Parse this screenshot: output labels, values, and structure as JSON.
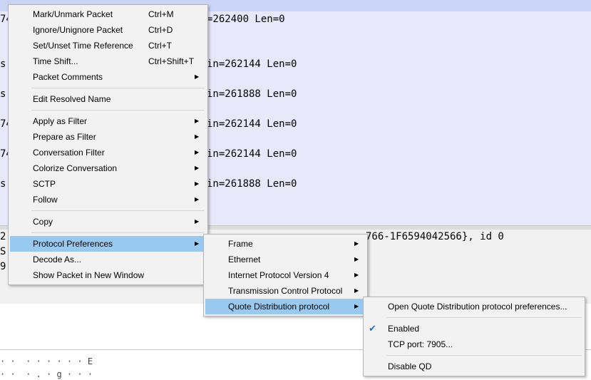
{
  "packet_list": {
    "rows": [
      {
        "left": "74",
        "right": "=262400 Len=0"
      },
      {
        "left": "",
        "right": ""
      },
      {
        "left": "s",
        "right": "in=262144 Len=0"
      },
      {
        "left": "s",
        "right": "in=261888 Len=0"
      },
      {
        "left": "74",
        "right": "in=262144 Len=0"
      },
      {
        "left": "74",
        "right": "in=262144 Len=0"
      },
      {
        "left": "s",
        "right": "in=261888 Len=0"
      }
    ]
  },
  "details": {
    "row1_left": "2",
    "row1_right": "766-1F6594042566}, id 0",
    "row2_left": "S",
    "row3_left": "9",
    "row4_left": ", ..., ..., ...",
    "row4_text": ", ... ..., ..... .. .... ..."
  },
  "bytes": {
    "row1": "· ·  · · · · · · E",
    "row2": "· ·  · . · g · · ·"
  },
  "context_menu": {
    "items": [
      {
        "label": "Mark/Unmark Packet",
        "shortcut": "Ctrl+M"
      },
      {
        "label": "Ignore/Unignore Packet",
        "shortcut": "Ctrl+D"
      },
      {
        "label": "Set/Unset Time Reference",
        "shortcut": "Ctrl+T"
      },
      {
        "label": "Time Shift...",
        "shortcut": "Ctrl+Shift+T"
      },
      {
        "label": "Packet Comments",
        "shortcut": ""
      },
      {
        "label": "Edit Resolved Name",
        "shortcut": ""
      },
      {
        "label": "Apply as Filter",
        "shortcut": ""
      },
      {
        "label": "Prepare as Filter",
        "shortcut": ""
      },
      {
        "label": "Conversation Filter",
        "shortcut": ""
      },
      {
        "label": "Colorize Conversation",
        "shortcut": ""
      },
      {
        "label": "SCTP",
        "shortcut": ""
      },
      {
        "label": "Follow",
        "shortcut": ""
      },
      {
        "label": "Copy",
        "shortcut": ""
      },
      {
        "label": "Protocol Preferences",
        "shortcut": ""
      },
      {
        "label": "Decode As...",
        "shortcut": ""
      },
      {
        "label": "Show Packet in New Window",
        "shortcut": ""
      }
    ]
  },
  "protocol_menu": {
    "items": [
      {
        "label": "Frame"
      },
      {
        "label": "Ethernet"
      },
      {
        "label": "Internet Protocol Version 4"
      },
      {
        "label": "Transmission Control Protocol"
      },
      {
        "label": "Quote Distribution protocol"
      }
    ]
  },
  "qd_menu": {
    "open_prefs": "Open Quote Distribution protocol preferences...",
    "enabled": "Enabled",
    "tcp_port": "TCP port: 7905...",
    "disable": "Disable QD"
  },
  "colors": {
    "highlight": "#99c9ef",
    "packet_bg": "#e8e8fb",
    "menu_bg": "#f2f2f2"
  }
}
